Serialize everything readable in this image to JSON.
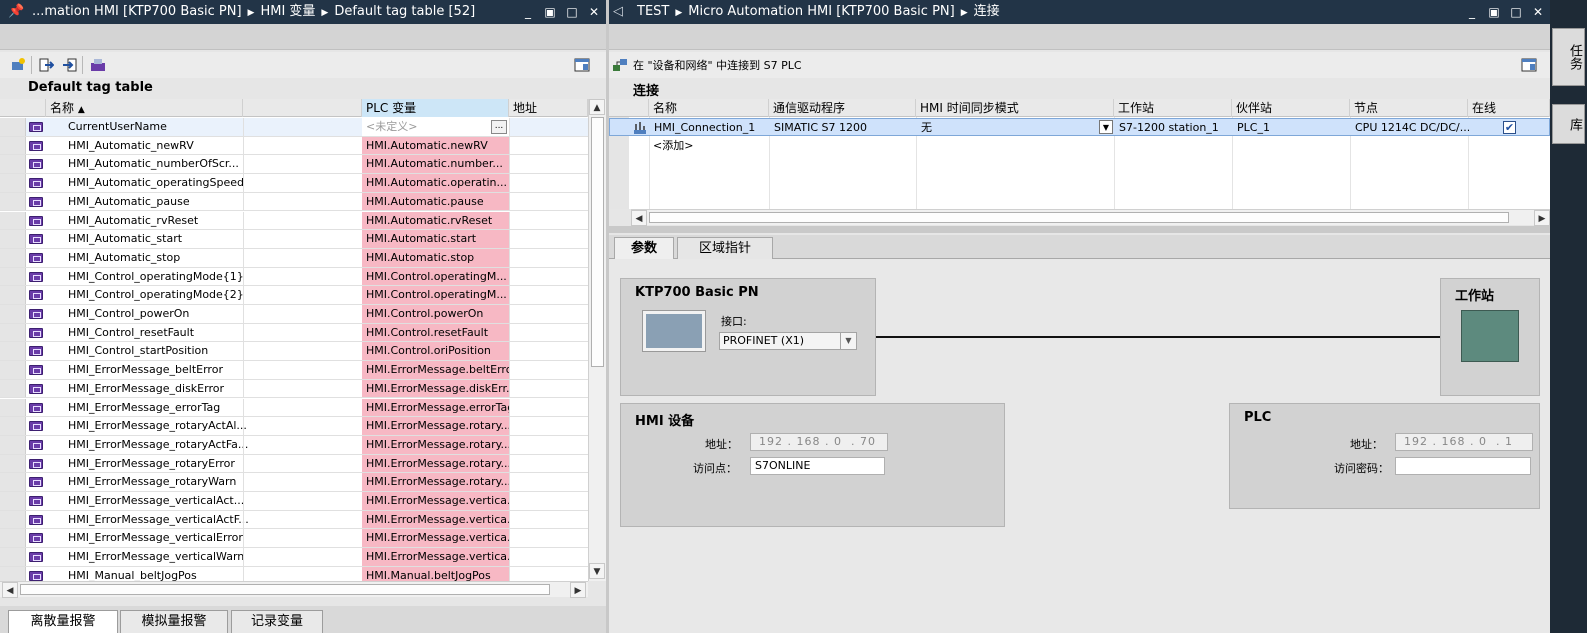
{
  "left_panel": {
    "title": {
      "segments": [
        "...mation HMI [KTP700 Basic PN]",
        "HMI 变量",
        "Default tag table [52]"
      ]
    },
    "table_caption": "Default tag table",
    "columns": {
      "name": "名称",
      "plc_tag": "PLC 变量",
      "address": "地址"
    },
    "rows": [
      {
        "name": "CurrentUserName",
        "plc": "<未定义>"
      },
      {
        "name": "HMI_Automatic_newRV",
        "plc": "HMI.Automatic.newRV"
      },
      {
        "name": "HMI_Automatic_numberOfScr...",
        "plc": "HMI.Automatic.number..."
      },
      {
        "name": "HMI_Automatic_operatingSpeed",
        "plc": "HMI.Automatic.operatin..."
      },
      {
        "name": "HMI_Automatic_pause",
        "plc": "HMI.Automatic.pause"
      },
      {
        "name": "HMI_Automatic_rvReset",
        "plc": "HMI.Automatic.rvReset"
      },
      {
        "name": "HMI_Automatic_start",
        "plc": "HMI.Automatic.start"
      },
      {
        "name": "HMI_Automatic_stop",
        "plc": "HMI.Automatic.stop"
      },
      {
        "name": "HMI_Control_operatingMode{1}",
        "plc": "HMI.Control.operatingM..."
      },
      {
        "name": "HMI_Control_operatingMode{2}",
        "plc": "HMI.Control.operatingM..."
      },
      {
        "name": "HMI_Control_powerOn",
        "plc": "HMI.Control.powerOn"
      },
      {
        "name": "HMI_Control_resetFault",
        "plc": "HMI.Control.resetFault"
      },
      {
        "name": "HMI_Control_startPosition",
        "plc": "HMI.Control.oriPosition"
      },
      {
        "name": "HMI_ErrorMessage_beltError",
        "plc": "HMI.ErrorMessage.beltErro"
      },
      {
        "name": "HMI_ErrorMessage_diskError",
        "plc": "HMI.ErrorMessage.diskErr..."
      },
      {
        "name": "HMI_ErrorMessage_errorTag",
        "plc": "HMI.ErrorMessage.errorTag"
      },
      {
        "name": "HMI_ErrorMessage_rotaryActAl...",
        "plc": "HMI.ErrorMessage.rotary..."
      },
      {
        "name": "HMI_ErrorMessage_rotaryActFa...",
        "plc": "HMI.ErrorMessage.rotary..."
      },
      {
        "name": "HMI_ErrorMessage_rotaryError",
        "plc": "HMI.ErrorMessage.rotary..."
      },
      {
        "name": "HMI_ErrorMessage_rotaryWarn",
        "plc": "HMI.ErrorMessage.rotary..."
      },
      {
        "name": "HMI_ErrorMessage_verticalAct...",
        "plc": "HMI.ErrorMessage.vertica..."
      },
      {
        "name": "HMI_ErrorMessage_verticalActF...",
        "plc": "HMI.ErrorMessage.vertica..."
      },
      {
        "name": "HMI_ErrorMessage_verticalError",
        "plc": "HMI.ErrorMessage.vertica..."
      },
      {
        "name": "HMI_ErrorMessage_verticalWarn",
        "plc": "HMI.ErrorMessage.vertica..."
      },
      {
        "name": "HMI_Manual_beltJogPos",
        "plc": "HMI.Manual.beltJogPos"
      }
    ],
    "bottom_tabs": [
      "离散量报警",
      "模拟量报警",
      "记录变量"
    ]
  },
  "right_panel": {
    "title": {
      "segments": [
        "TEST",
        "Micro Automation HMI [KTP700 Basic PN]",
        "连接"
      ]
    },
    "subtitle": "在 \"设备和网络\" 中连接到 S7 PLC",
    "caption": "连接",
    "columns": {
      "name": "名称",
      "driver": "通信驱动程序",
      "sync": "HMI 时间同步模式",
      "station": "工作站",
      "partner": "伙伴站",
      "node": "节点",
      "online": "在线"
    },
    "connection": {
      "name": "HMI_Connection_1",
      "driver": "SIMATIC S7 1200",
      "sync": "无",
      "station": "S7-1200 station_1",
      "partner": "PLC_1",
      "node": "CPU 1214C DC/DC/..."
    },
    "add_label": "<添加>",
    "tabs": [
      "参数",
      "区域指针"
    ],
    "device": {
      "title": "KTP700 Basic PN",
      "interface_label": "接口:",
      "interface_value": "PROFINET (X1)"
    },
    "station_title": "工作站",
    "hmi_device": {
      "title": "HMI 设备",
      "address_label": "地址：",
      "ip": [
        "192",
        "168",
        "0",
        "70"
      ],
      "access_label": "访问点：",
      "access_value": "S7ONLINE"
    },
    "plc": {
      "title": "PLC",
      "address_label": "地址：",
      "ip": [
        "192",
        "168",
        "0",
        "1"
      ],
      "password_label": "访问密码："
    }
  },
  "side_tabs": [
    "任务",
    "库"
  ],
  "colors": {
    "titlebar": "#223447",
    "plc_cell": "#f7b8c4",
    "tag_icon": "#6a3ca8",
    "selected_row": "#cfe2fb"
  }
}
